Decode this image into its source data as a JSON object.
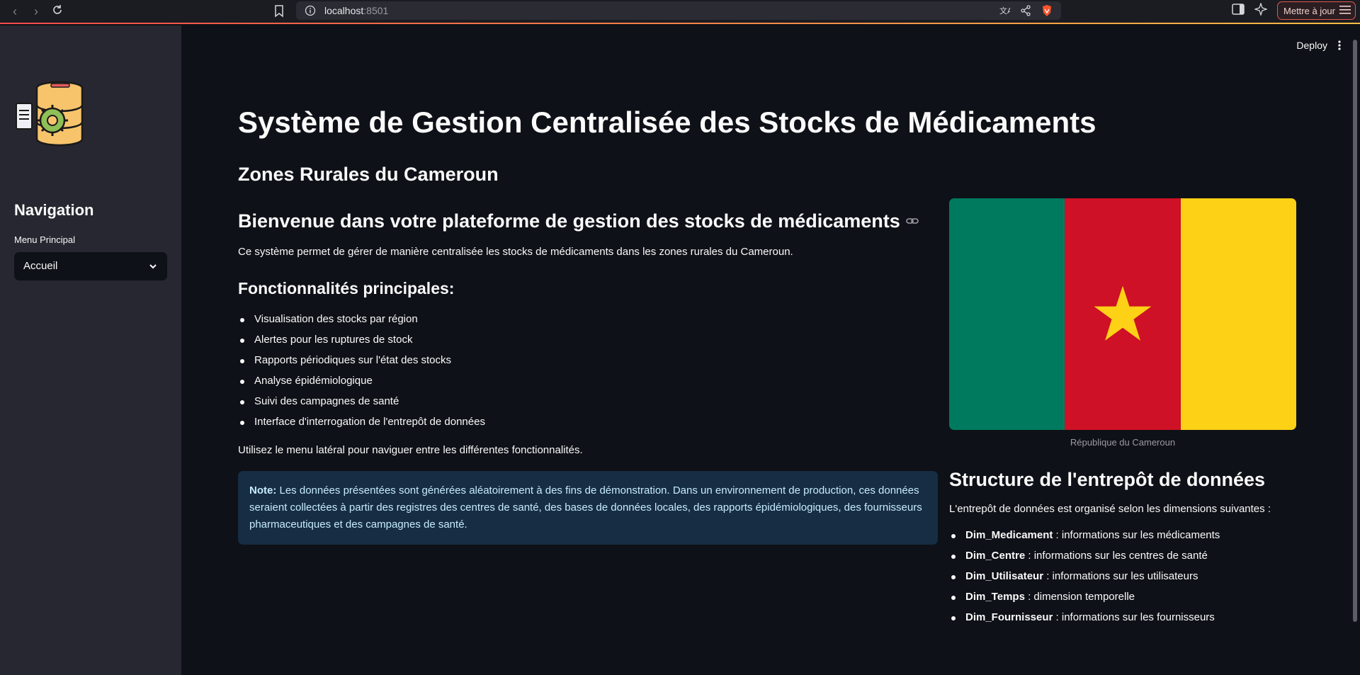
{
  "browser": {
    "url_host": "localhost",
    "url_port": ":8501",
    "update_label": "Mettre à jour"
  },
  "sidebar": {
    "nav_title": "Navigation",
    "menu_label": "Menu Principal",
    "selected_page": "Accueil"
  },
  "header": {
    "deploy_label": "Deploy"
  },
  "main": {
    "title": "Système de Gestion Centralisée des Stocks de Médicaments",
    "subtitle": "Zones Rurales du Cameroun",
    "welcome_heading": "Bienvenue dans votre plateforme de gestion des stocks de médicaments",
    "intro": "Ce système permet de gérer de manière centralisée les stocks de médicaments dans les zones rurales du Cameroun.",
    "features_title": "Fonctionnalités principales:",
    "features": [
      "Visualisation des stocks par région",
      "Alertes pour les ruptures de stock",
      "Rapports périodiques sur l'état des stocks",
      "Analyse épidémiologique",
      "Suivi des campagnes de santé",
      "Interface d'interrogation de l'entrepôt de données"
    ],
    "nav_hint": "Utilisez le menu latéral pour naviguer entre les différentes fonctionnalités.",
    "note_label": "Note:",
    "note_text": " Les données présentées sont générées aléatoirement à des fins de démonstration. Dans un environnement de production, ces données seraient collectées à partir des registres des centres de santé, des bases de données locales, des rapports épidémiologiques, des fournisseurs pharmaceutiques et des campagnes de santé."
  },
  "right": {
    "flag_colors": [
      "#007a5e",
      "#ce1126",
      "#fcd116"
    ],
    "flag_caption": "République du Cameroun",
    "dw_title": "Structure de l'entrepôt de données",
    "dw_intro": "L'entrepôt de données est organisé selon les dimensions suivantes :",
    "dimensions": [
      {
        "name": "Dim_Medicament",
        "desc": " : informations sur les médicaments"
      },
      {
        "name": "Dim_Centre",
        "desc": " : informations sur les centres de santé"
      },
      {
        "name": "Dim_Utilisateur",
        "desc": " : informations sur les utilisateurs"
      },
      {
        "name": "Dim_Temps",
        "desc": " : dimension temporelle"
      },
      {
        "name": "Dim_Fournisseur",
        "desc": " : informations sur les fournisseurs"
      }
    ]
  }
}
